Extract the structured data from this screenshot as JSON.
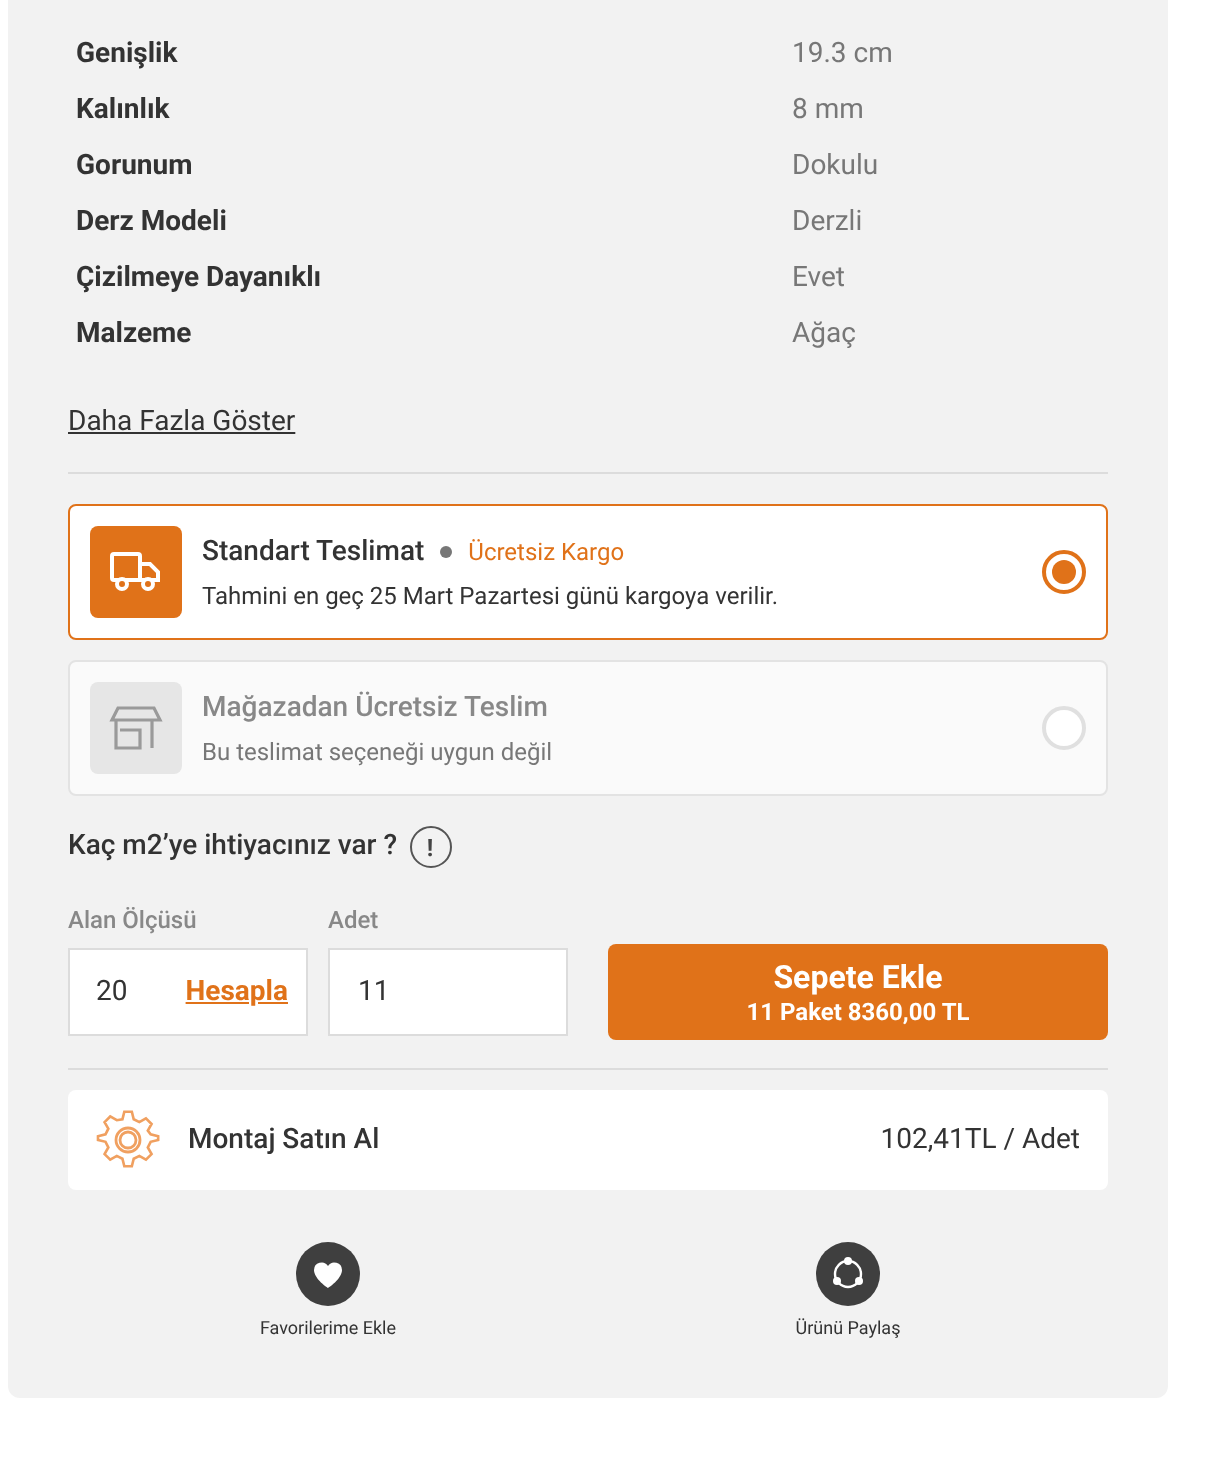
{
  "specs": [
    {
      "label": "Genişlik",
      "value": "19.3 cm"
    },
    {
      "label": "Kalınlık",
      "value": "8 mm"
    },
    {
      "label": "Gorunum",
      "value": "Dokulu"
    },
    {
      "label": "Derz Modeli",
      "value": "Derzli"
    },
    {
      "label": "Çizilmeye Dayanıklı",
      "value": "Evet"
    },
    {
      "label": "Malzeme",
      "value": "Ağaç"
    }
  ],
  "show_more": "Daha Fazla Göster",
  "delivery_options": [
    {
      "kind": "truck",
      "title": "Standart Teslimat",
      "badge": "Ücretsiz Kargo",
      "note": "Tahmini en geç 25 Mart Pazartesi günü kargoya verilir.",
      "selected": true,
      "disabled": false
    },
    {
      "kind": "store",
      "title": "Mağazadan Ücretsiz Teslim",
      "note": "Bu teslimat seçeneği uygun değil",
      "selected": false,
      "disabled": true
    }
  ],
  "question": "Kaç m2’ye ihtiyacınız var ?",
  "info_icon": "!",
  "area": {
    "label": "Alan Ölçüsü",
    "value": "20",
    "link": "Hesapla"
  },
  "quantity": {
    "label": "Adet",
    "value": "11"
  },
  "add_to_cart": {
    "title": "Sepete Ekle",
    "subtitle": "11 Paket 8360,00 TL"
  },
  "assembly": {
    "title": "Montaj Satın Al",
    "price": "102,41TL / Adet"
  },
  "actions": [
    {
      "kind": "favorite",
      "label": "Favorilerime Ekle"
    },
    {
      "kind": "share",
      "label": "Ürünü Paylaş"
    }
  ]
}
